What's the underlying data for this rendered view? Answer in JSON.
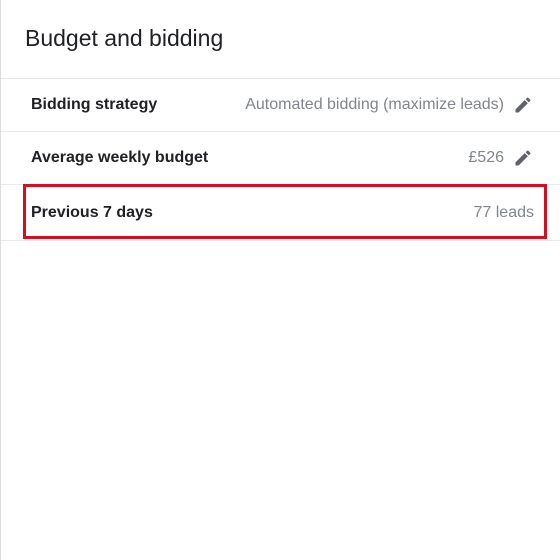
{
  "panel": {
    "title": "Budget and bidding"
  },
  "rows": [
    {
      "label": "Bidding strategy",
      "value": "Automated bidding (maximize leads)",
      "editable": true
    },
    {
      "label": "Average weekly budget",
      "value": "£526",
      "editable": true
    },
    {
      "label": "Previous 7 days",
      "value": "77 leads",
      "editable": false
    }
  ],
  "colors": {
    "highlight": "#d50f1f",
    "label": "#202124",
    "value": "#80868b",
    "icon": "#5f6368"
  },
  "icons": {
    "edit": "pencil-icon"
  }
}
